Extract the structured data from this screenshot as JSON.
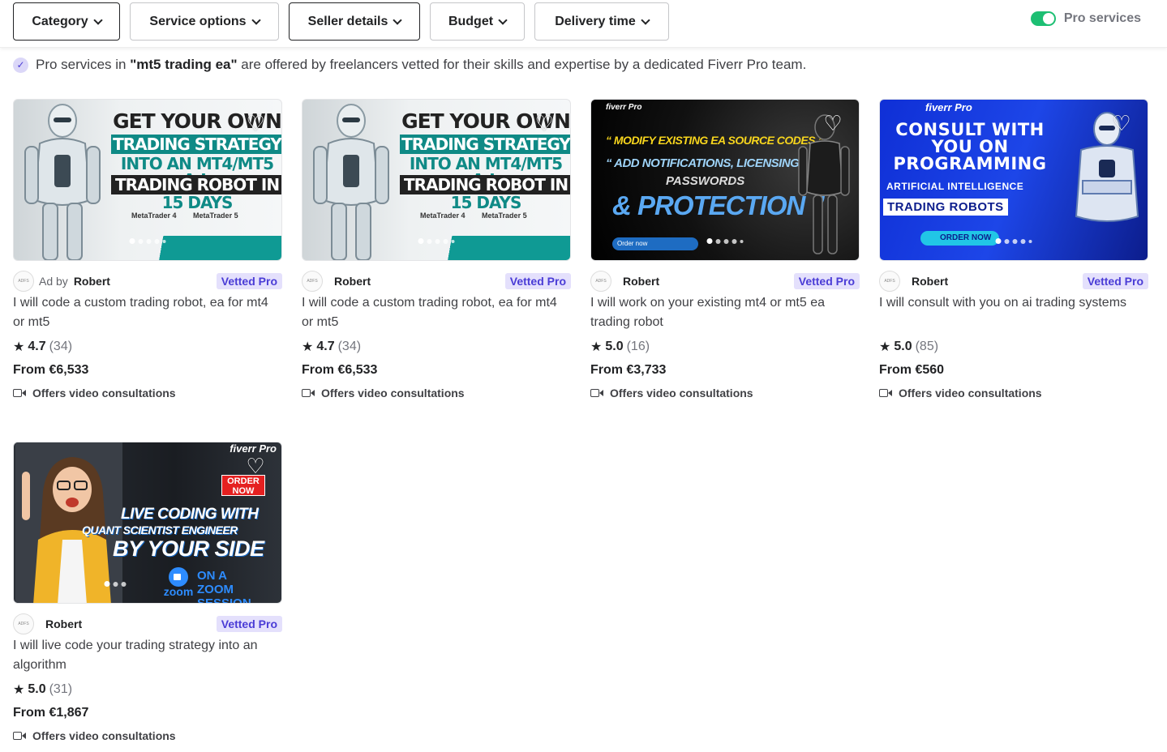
{
  "filters": {
    "category": "Category",
    "service_options": "Service options",
    "seller_details": "Seller details",
    "budget": "Budget",
    "delivery_time": "Delivery time"
  },
  "pro_toggle": {
    "label": "Pro services",
    "on": true
  },
  "info": {
    "prefix": "Pro services in",
    "query": "\"mt5 trading ea\"",
    "suffix": "are offered by freelancers vetted for their skills and expertise by a dedicated Fiverr Pro team."
  },
  "gigs": [
    {
      "ad_by": "Ad by",
      "seller": "Robert",
      "badge": "Vetted Pro",
      "title": "I will code a custom trading robot, ea for mt4 or mt5",
      "rating": "4.7",
      "reviews": "(34)",
      "price": "From €6,533",
      "consult": "Offers video consultations",
      "art": {
        "l1": "GET YOUR OWN",
        "l2": "TRADING STRATEGY",
        "l3": "INTO AN MT4/MT5 A.I.",
        "l4": "TRADING ROBOT IN",
        "l5": "15 DAYS",
        "logo1": "MetaTrader 4",
        "logo2": "MetaTrader 5"
      }
    },
    {
      "seller": "Robert",
      "badge": "Vetted Pro",
      "title": "I will code a custom trading robot, ea for mt4 or mt5",
      "rating": "4.7",
      "reviews": "(34)",
      "price": "From €6,533",
      "consult": "Offers video consultations",
      "art": {
        "l1": "GET YOUR OWN",
        "l2": "TRADING STRATEGY",
        "l3": "INTO AN MT4/MT5 A.I.",
        "l4": "TRADING ROBOT IN",
        "l5": "15 DAYS",
        "logo1": "MetaTrader 4",
        "logo2": "MetaTrader 5"
      }
    },
    {
      "seller": "Robert",
      "badge": "Vetted Pro",
      "title": "I will work on your existing mt4 or mt5 ea trading robot",
      "rating": "5.0",
      "reviews": "(16)",
      "price": "From €3,733",
      "consult": "Offers video consultations",
      "art": {
        "brand": "fiverr Pro",
        "l1": "“ MODIFY EXISTING EA SOURCE CODES ”",
        "l2": "“ ADD NOTIFICATIONS, LICENSING,",
        "l3": "PASSWORDS",
        "l4": "& PROTECTION ”",
        "order": "Order now"
      }
    },
    {
      "seller": "Robert",
      "badge": "Vetted Pro",
      "title": "I will consult with you on ai trading systems",
      "rating": "5.0",
      "reviews": "(85)",
      "price": "From €560",
      "consult": "Offers video consultations",
      "art": {
        "brand": "fiverr Pro",
        "l1": "CONSULT WITH YOU ON PROGRAMMING",
        "l2": "ARTIFICIAL INTELLIGENCE",
        "l3": "TRADING ROBOTS",
        "order": "ORDER NOW"
      }
    },
    {
      "seller": "Robert",
      "badge": "Vetted Pro",
      "title": "I will live code your trading strategy into an algorithm",
      "rating": "5.0",
      "reviews": "(31)",
      "price": "From €1,867",
      "consult": "Offers video consultations",
      "art": {
        "brand": "fiverr Pro",
        "order": "ORDER NOW",
        "l1": "LIVE CODING WITH",
        "l2": "QUANT SCIENTIST ENGINEER",
        "l3": "BY YOUR SIDE",
        "zoom": "zoom",
        "session": "ON A ZOOM SESSION"
      }
    }
  ],
  "avatar_text": "ADFS",
  "colors": {
    "accent_green": "#1dbf73",
    "vetted_bg": "#e4e0fc",
    "vetted_text": "#4a3cd6"
  }
}
